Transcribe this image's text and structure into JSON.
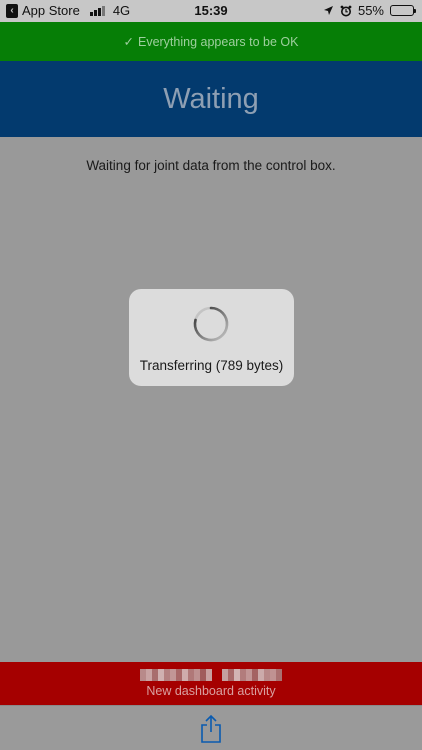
{
  "status_bar": {
    "back_app": "App Store",
    "network": "4G",
    "time": "15:39",
    "battery_percent": "55%",
    "battery_level": 0.55
  },
  "banner": {
    "check": "✓",
    "text": "Everything appears to be OK",
    "color": "#067e06"
  },
  "header": {
    "title": "Waiting",
    "color": "#033a6e"
  },
  "main": {
    "message": "Waiting for joint data from the control box."
  },
  "hud": {
    "label": "Transferring (789 bytes)",
    "icon": "spinner-icon"
  },
  "activity_bar": {
    "text": "New dashboard activity",
    "color": "#a50000"
  },
  "toolbar": {
    "share_icon": "share-icon"
  }
}
